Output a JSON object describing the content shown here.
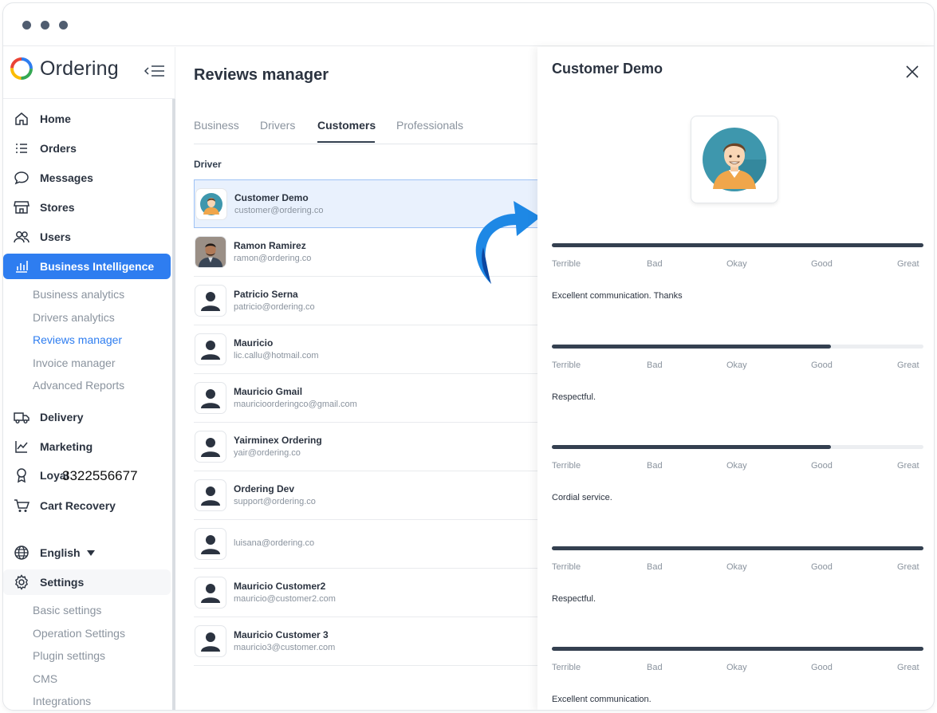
{
  "app": {
    "logo_text": "Ordering"
  },
  "sidebar": {
    "items": [
      {
        "label": "Home",
        "icon": "home-icon"
      },
      {
        "label": "Orders",
        "icon": "list-icon"
      },
      {
        "label": "Messages",
        "icon": "chat-icon"
      },
      {
        "label": "Stores",
        "icon": "store-icon"
      },
      {
        "label": "Users",
        "icon": "users-icon"
      },
      {
        "label": "Business Intelligence",
        "icon": "chart-bars-icon"
      },
      {
        "label": "Delivery",
        "icon": "truck-icon"
      },
      {
        "label": "Marketing",
        "icon": "trend-icon"
      },
      {
        "label": "Loyal",
        "icon": "award-icon"
      },
      {
        "label": "Cart Recovery",
        "icon": "cart-icon"
      },
      {
        "label": "English",
        "icon": "globe-icon"
      },
      {
        "label": "Settings",
        "icon": "gear-icon"
      }
    ],
    "bi_sub": [
      "Business analytics",
      "Drivers analytics",
      "Reviews manager",
      "Invoice manager",
      "Advanced Reports"
    ],
    "settings_sub": [
      "Basic settings",
      "Operation Settings",
      "Plugin settings",
      "CMS",
      "Integrations"
    ],
    "loyalty_overlay": "3322556677"
  },
  "main": {
    "title": "Reviews manager",
    "tabs": [
      "Business",
      "Drivers",
      "Customers",
      "Professionals"
    ],
    "active_tab": "Customers",
    "column_header": "Driver",
    "rows": [
      {
        "name": "Customer Demo",
        "email": "customer@ordering.co",
        "avatar": "cartoon"
      },
      {
        "name": "Ramon Ramirez",
        "email": "ramon@ordering.co",
        "avatar": "photo"
      },
      {
        "name": "Patricio Serna",
        "email": "patricio@ordering.co",
        "avatar": "default"
      },
      {
        "name": "Mauricio",
        "email": "lic.callu@hotmail.com",
        "avatar": "default"
      },
      {
        "name": "Mauricio Gmail",
        "email": "mauricioorderingco@gmail.com",
        "avatar": "default"
      },
      {
        "name": "Yairminex Ordering",
        "email": "yair@ordering.co",
        "avatar": "default"
      },
      {
        "name": "Ordering Dev",
        "email": "support@ordering.co",
        "avatar": "default"
      },
      {
        "name": "",
        "email": "luisana@ordering.co",
        "avatar": "default"
      },
      {
        "name": "Mauricio Customer2",
        "email": "mauricio@customer2.com",
        "avatar": "default"
      },
      {
        "name": "Mauricio Customer 3",
        "email": "mauricio3@customer.com",
        "avatar": "default"
      }
    ]
  },
  "panel": {
    "title": "Customer Demo",
    "scale_labels": [
      "Terrible",
      "Bad",
      "Okay",
      "Good",
      "Great"
    ],
    "reviews": [
      {
        "rating_fraction": 1.0,
        "comment": "Excellent communication. Thanks"
      },
      {
        "rating_fraction": 0.75,
        "comment": "Respectful."
      },
      {
        "rating_fraction": 0.75,
        "comment": "Cordial service."
      },
      {
        "rating_fraction": 1.0,
        "comment": "Respectful."
      },
      {
        "rating_fraction": 1.0,
        "comment": "Excellent communication."
      }
    ]
  },
  "colors": {
    "accent": "#2e7df0",
    "dark": "#344050",
    "muted": "#8a939e",
    "arrow": "#1e88e5"
  }
}
